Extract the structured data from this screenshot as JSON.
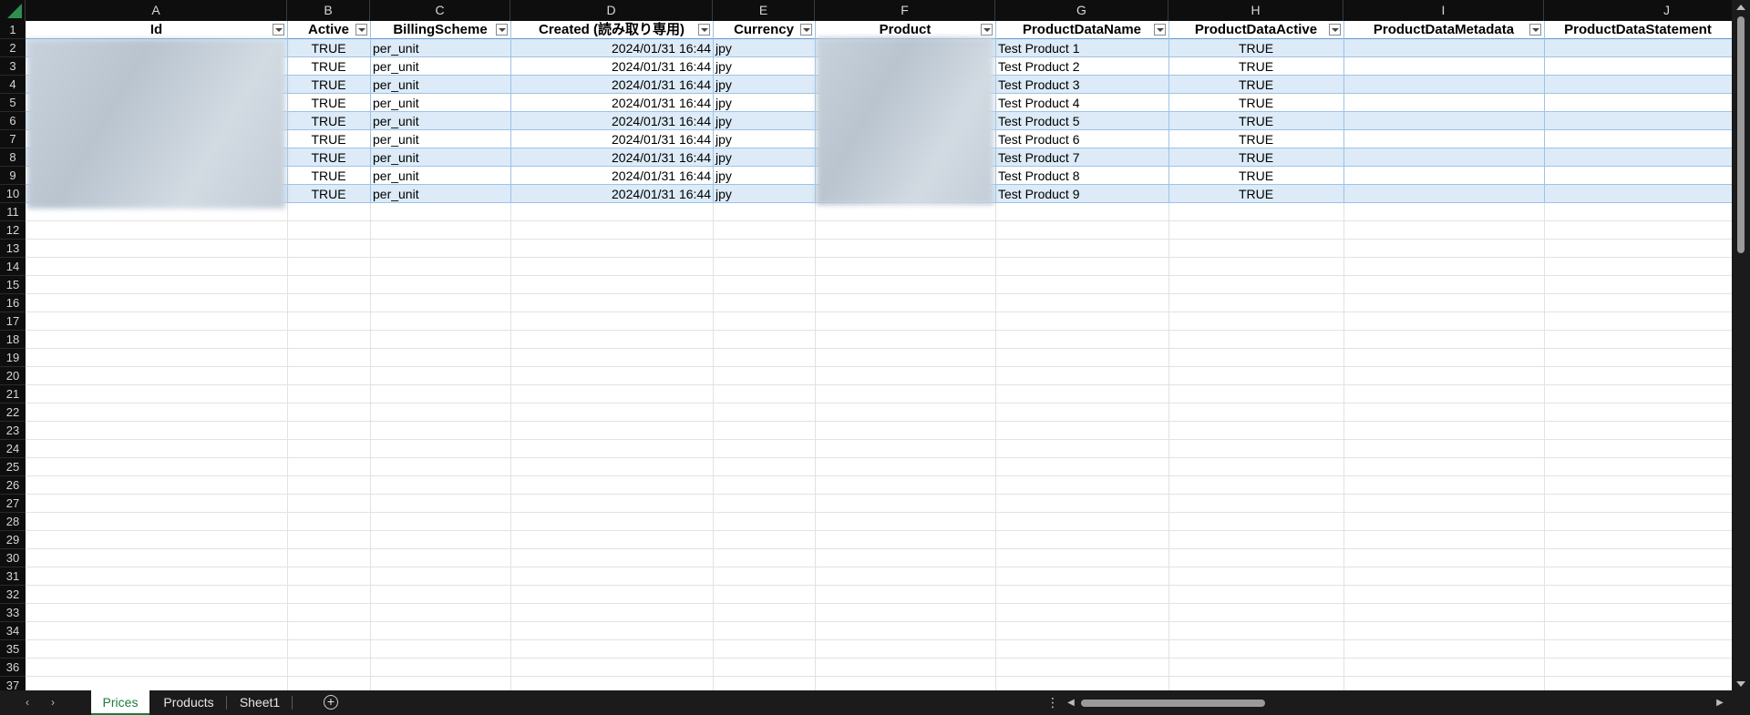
{
  "columns": [
    {
      "letter": "A",
      "header": "Id"
    },
    {
      "letter": "B",
      "header": "Active"
    },
    {
      "letter": "C",
      "header": "BillingScheme"
    },
    {
      "letter": "D",
      "header": "Created (読み取り専用)"
    },
    {
      "letter": "E",
      "header": "Currency"
    },
    {
      "letter": "F",
      "header": "Product"
    },
    {
      "letter": "G",
      "header": "ProductDataName"
    },
    {
      "letter": "H",
      "header": "ProductDataActive"
    },
    {
      "letter": "I",
      "header": "ProductDataMetadata"
    },
    {
      "letter": "J",
      "header": "ProductDataStatement"
    }
  ],
  "rows": [
    {
      "active": "TRUE",
      "billing": "per_unit",
      "created": "2024/01/31 16:44",
      "currency": "jpy",
      "name": "Test Product 1",
      "pactive": "TRUE"
    },
    {
      "active": "TRUE",
      "billing": "per_unit",
      "created": "2024/01/31 16:44",
      "currency": "jpy",
      "name": "Test Product 2",
      "pactive": "TRUE"
    },
    {
      "active": "TRUE",
      "billing": "per_unit",
      "created": "2024/01/31 16:44",
      "currency": "jpy",
      "name": "Test Product 3",
      "pactive": "TRUE"
    },
    {
      "active": "TRUE",
      "billing": "per_unit",
      "created": "2024/01/31 16:44",
      "currency": "jpy",
      "name": "Test Product 4",
      "pactive": "TRUE"
    },
    {
      "active": "TRUE",
      "billing": "per_unit",
      "created": "2024/01/31 16:44",
      "currency": "jpy",
      "name": "Test Product 5",
      "pactive": "TRUE"
    },
    {
      "active": "TRUE",
      "billing": "per_unit",
      "created": "2024/01/31 16:44",
      "currency": "jpy",
      "name": "Test Product 6",
      "pactive": "TRUE"
    },
    {
      "active": "TRUE",
      "billing": "per_unit",
      "created": "2024/01/31 16:44",
      "currency": "jpy",
      "name": "Test Product 7",
      "pactive": "TRUE"
    },
    {
      "active": "TRUE",
      "billing": "per_unit",
      "created": "2024/01/31 16:44",
      "currency": "jpy",
      "name": "Test Product 8",
      "pactive": "TRUE"
    },
    {
      "active": "TRUE",
      "billing": "per_unit",
      "created": "2024/01/31 16:44",
      "currency": "jpy",
      "name": "Test Product 9",
      "pactive": "TRUE"
    }
  ],
  "row_numbers": [
    "1",
    "2",
    "3",
    "4",
    "5",
    "6",
    "7",
    "8",
    "9",
    "10",
    "11",
    "12",
    "13",
    "14",
    "15",
    "16",
    "17",
    "18",
    "19",
    "20",
    "21",
    "22",
    "23",
    "24",
    "25",
    "26",
    "27",
    "28",
    "29",
    "30",
    "31",
    "32",
    "33",
    "34",
    "35",
    "36",
    "37"
  ],
  "tabs": {
    "prev": "‹",
    "next": "›",
    "sheets": [
      "Prices",
      "Products",
      "Sheet1"
    ],
    "active": "Prices",
    "add": "+",
    "more": "⋮"
  },
  "colors": {
    "table_band": "#dcebf7",
    "table_border": "#9dc3e6",
    "active_tab_text": "#1f7a3f",
    "header_bg": "#0e0e0e"
  }
}
